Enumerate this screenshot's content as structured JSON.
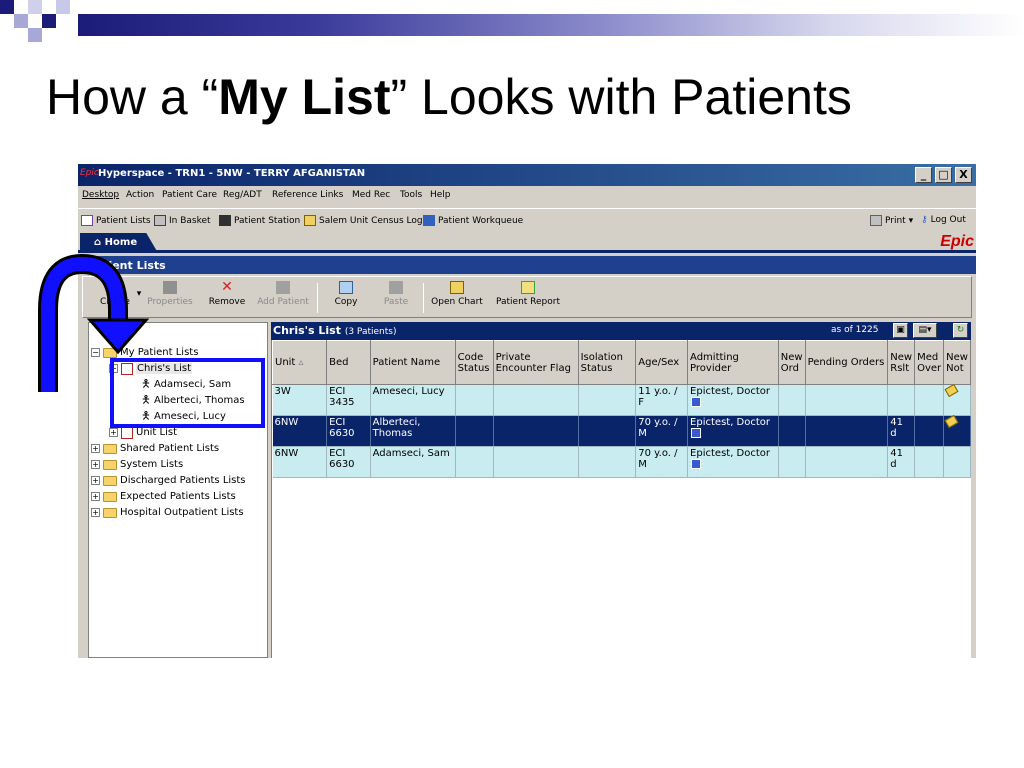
{
  "slide": {
    "title_pre": "How a “",
    "title_bold": "My List",
    "title_post": "” Looks with Patients"
  },
  "window": {
    "app_prefix": "Epic",
    "title": "Hyperspace - TRN1 - 5NW - TERRY AFGANISTAN",
    "buttons": [
      "_",
      "□",
      "X"
    ]
  },
  "menu": [
    "Desktop",
    "Action",
    "Patient Care",
    "Reg/ADT",
    "Reference Links",
    "Med Rec",
    "Tools",
    "Help"
  ],
  "toolbar1": {
    "items": [
      "Patient Lists",
      "In Basket",
      "Patient Station",
      "Salem Unit Census Log",
      "Patient Workqueue"
    ],
    "print": "Print ▾",
    "logout": "Log Out"
  },
  "tabs": {
    "home": "Home",
    "logo": "Epic"
  },
  "panel": {
    "title": "Patient Lists"
  },
  "toolbar2": {
    "create": "Create",
    "properties": "Properties",
    "remove": "Remove",
    "add_patient": "Add Patient",
    "copy": "Copy",
    "paste": "Paste",
    "open_chart": "Open Chart",
    "patient_report": "Patient Report"
  },
  "tree": {
    "my_lists": "My Patient Lists",
    "chris_list": "Chris's List",
    "patients": [
      "Adamseci, Sam",
      "Alberteci, Thomas",
      "Ameseci, Lucy"
    ],
    "unit_list": "Unit List",
    "folders": [
      "Shared Patient Lists",
      "System Lists",
      "Discharged Patients Lists",
      "Expected Patients Lists",
      "Hospital Outpatient Lists"
    ]
  },
  "grid": {
    "list_name": "Chris's List",
    "count": "(3 Patients)",
    "as_of": "as of 1225",
    "columns": [
      "Unit",
      "Bed",
      "Patient Name",
      "Code Status",
      "Private Encounter Flag",
      "Isolation Status",
      "Age/Sex",
      "Admitting Provider",
      "New Ord",
      "Pending Orders",
      "New Rslt",
      "Med Over",
      "New Not"
    ],
    "rows": [
      {
        "unit": "3W",
        "bed": "ECI 3435",
        "name": "Ameseci, Lucy",
        "age": "11 y.o. / F",
        "provider": "Epictest, Doctor",
        "rslt": ""
      },
      {
        "unit": "6NW",
        "bed": "ECI 6630",
        "name": "Alberteci, Thomas",
        "age": "70 y.o. / M",
        "provider": "Epictest, Doctor",
        "rslt": "41 d"
      },
      {
        "unit": "6NW",
        "bed": "ECI 6630",
        "name": "Adamseci, Sam",
        "age": "70 y.o. / M",
        "provider": "Epictest, Doctor",
        "rslt": "41 d"
      }
    ]
  },
  "colors": {
    "title_bar": "#0a246a",
    "selection_box": "#1010ff",
    "arrow": "#1010ff",
    "row_tint": "#c8ecf0"
  }
}
